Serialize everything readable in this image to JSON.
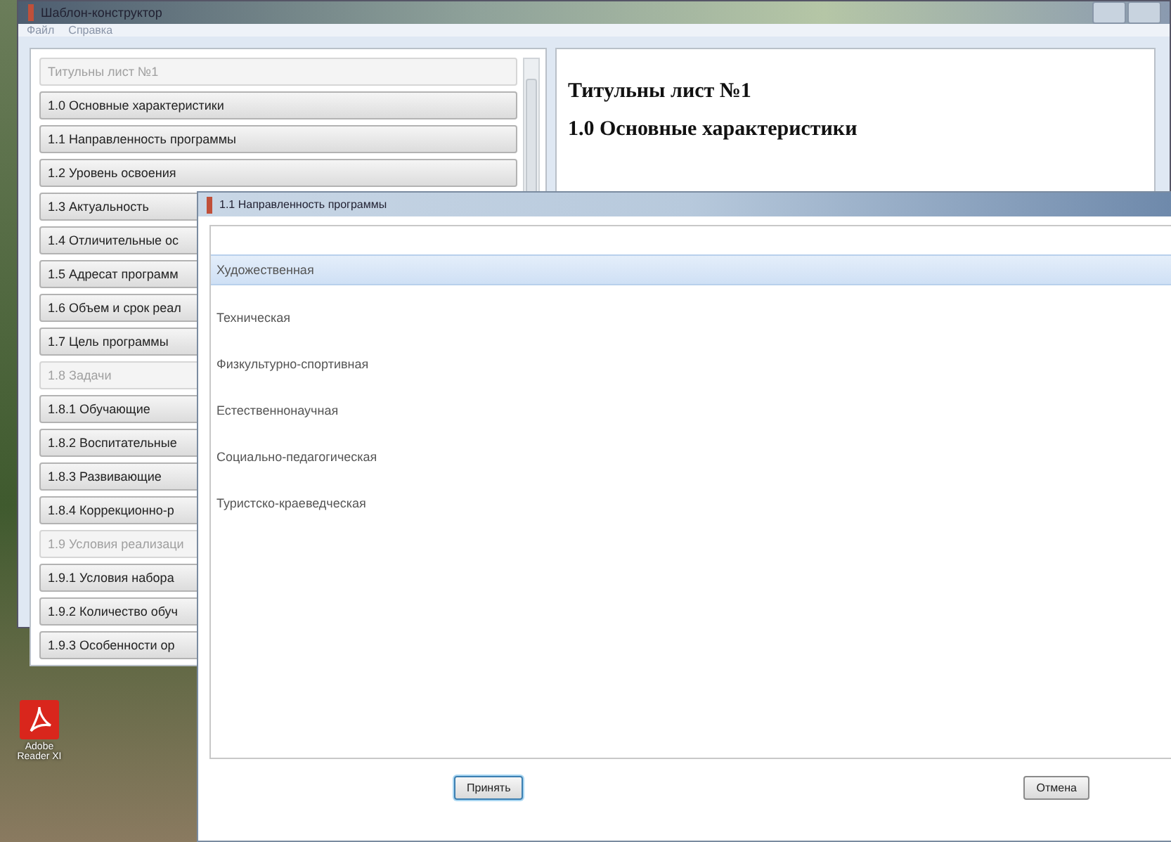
{
  "main_window": {
    "title": "Шаблон-конструктор",
    "menu": [
      "Файл",
      "Справка"
    ],
    "sections": [
      {
        "label": "Титульны лист №1",
        "disabled": true
      },
      {
        "label": "1.0 Основные характеристики",
        "disabled": false
      },
      {
        "label": "1.1 Направленность программы",
        "disabled": false
      },
      {
        "label": "1.2 Уровень освоения",
        "disabled": false
      },
      {
        "label": "1.3 Актуальность",
        "disabled": false
      },
      {
        "label": "1.4 Отличительные ос",
        "disabled": false
      },
      {
        "label": "1.5 Адресат программ",
        "disabled": false
      },
      {
        "label": "1.6 Объем и срок реал",
        "disabled": false
      },
      {
        "label": "1.7 Цель программы",
        "disabled": false
      },
      {
        "label": "1.8 Задачи",
        "disabled": true
      },
      {
        "label": "1.8.1 Обучающие",
        "disabled": false
      },
      {
        "label": "1.8.2 Воспитательные",
        "disabled": false
      },
      {
        "label": "1.8.3 Развивающие",
        "disabled": false
      },
      {
        "label": "1.8.4 Коррекционно-р",
        "disabled": false
      },
      {
        "label": "1.9 Условия реализаци",
        "disabled": true
      },
      {
        "label": "1.9.1 Условия набора",
        "disabled": false
      },
      {
        "label": "1.9.2 Количество обуч",
        "disabled": false
      },
      {
        "label": "1.9.3 Особенности ор",
        "disabled": false
      }
    ],
    "preview": {
      "headings": [
        "Титульны лист №1",
        "1.0 Основные характеристики"
      ]
    }
  },
  "dialog": {
    "title": "1.1 Направленность программы",
    "options": [
      {
        "label": "Художественная",
        "selected": true
      },
      {
        "label": "Техническая",
        "selected": false
      },
      {
        "label": "Физкультурно-спортивная",
        "selected": false
      },
      {
        "label": "Естественнонаучная",
        "selected": false
      },
      {
        "label": "Социально-педагогическая",
        "selected": false
      },
      {
        "label": "Туристско-краеведческая",
        "selected": false
      }
    ],
    "buttons": [
      {
        "label": "Принять",
        "default": true
      },
      {
        "label": "Отмена",
        "default": false
      }
    ]
  },
  "desktop_icons": [
    {
      "label": "Adobe Reader XI"
    }
  ]
}
